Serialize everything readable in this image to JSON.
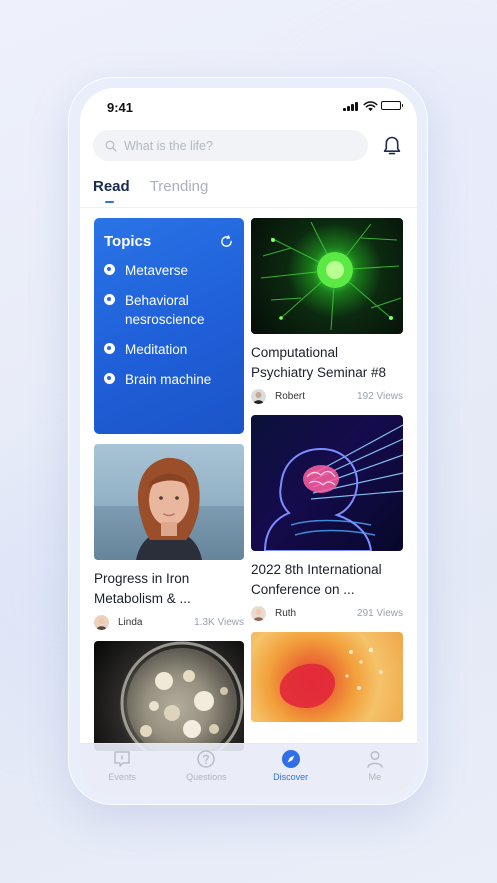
{
  "status_bar": {
    "time": "9:41"
  },
  "search": {
    "placeholder": "What is the life?"
  },
  "tabs": [
    {
      "label": "Read",
      "active": true
    },
    {
      "label": "Trending",
      "active": false
    }
  ],
  "topics": {
    "title": "Topics",
    "items": [
      "Metaverse",
      "Behavioral nesroscience",
      "Meditation",
      "Brain machine"
    ]
  },
  "feed": {
    "right": [
      {
        "title": "Computational Psychiatry Seminar #8",
        "author": "Robert",
        "views": "192 Views",
        "image": "neuron-microscopy"
      },
      {
        "title": "2022 8th International Conference on ...",
        "author": "Ruth",
        "views": "291 Views",
        "image": "brain-head-scan"
      },
      {
        "title": "",
        "author": "",
        "views": "",
        "image": "orange-cell-texture"
      }
    ],
    "left": [
      {
        "title": "Progress in Iron Metabolism & ...",
        "author": "Linda",
        "views": "1.3K Views",
        "image": "portrait-woman"
      },
      {
        "title": "",
        "author": "",
        "views": "",
        "image": "petri-dish"
      }
    ]
  },
  "bottom_nav": [
    {
      "label": "Events",
      "icon": "events-icon",
      "active": false
    },
    {
      "label": "Questions",
      "icon": "question-icon",
      "active": false
    },
    {
      "label": "Discover",
      "icon": "compass-icon",
      "active": true
    },
    {
      "label": "Me",
      "icon": "user-icon",
      "active": false
    }
  ],
  "colors": {
    "accent": "#2f6fe8",
    "topics_card": "#1f5fd8",
    "inactive": "#b0b6c3"
  }
}
